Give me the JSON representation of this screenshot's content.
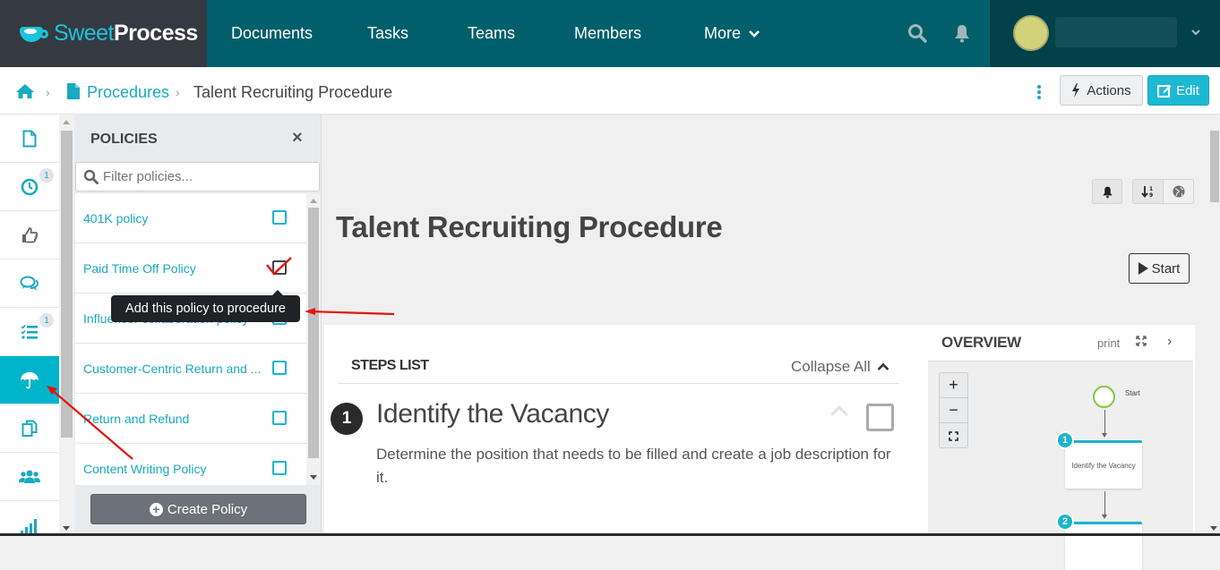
{
  "brand": {
    "name_part1": "Sweet",
    "name_part2": "Process"
  },
  "topnav": {
    "items": [
      "Documents",
      "Tasks",
      "Teams",
      "Members",
      "More"
    ],
    "search_icon": "search-icon",
    "bell_icon": "bell-icon",
    "user_caret": "⌄"
  },
  "breadcrumb": {
    "home_icon": "home-icon",
    "procedures": "Procedures",
    "current": "Talent Recruiting Procedure"
  },
  "header_actions": {
    "actions_label": "Actions",
    "edit_label": "Edit"
  },
  "sidebar": {
    "items": [
      {
        "icon": "document-icon",
        "badge": ""
      },
      {
        "icon": "clock-icon",
        "badge": "1"
      },
      {
        "icon": "thumbs-up-icon",
        "badge": ""
      },
      {
        "icon": "comments-icon",
        "badge": ""
      },
      {
        "icon": "checklist-icon",
        "badge": "1"
      },
      {
        "icon": "umbrella-icon",
        "badge": "",
        "active": true
      },
      {
        "icon": "copy-icon",
        "badge": ""
      },
      {
        "icon": "users-icon",
        "badge": ""
      },
      {
        "icon": "signal-icon",
        "badge": ""
      }
    ]
  },
  "policies_panel": {
    "title": "POLICIES",
    "close": "×",
    "filter_placeholder": "Filter policies...",
    "items": [
      {
        "name": "401K policy",
        "checked": false
      },
      {
        "name": "Paid Time Off Policy",
        "checked": true
      },
      {
        "name": "Influencer collaboration policy",
        "checked": false
      },
      {
        "name": "Customer-Centric Return and ...",
        "checked": false
      },
      {
        "name": "Return and Refund",
        "checked": false
      },
      {
        "name": "Content Writing Policy",
        "checked": false
      }
    ],
    "create_label": "Create Policy",
    "tooltip": "Add this policy to procedure"
  },
  "procedure": {
    "title": "Talent Recruiting Procedure",
    "start_label": "Start"
  },
  "steps": {
    "header": "STEPS LIST",
    "collapse_label": "Collapse All",
    "items": [
      {
        "number": "1",
        "title": "Identify the Vacancy",
        "description": "Determine the position that needs to be filled and create a job description for it."
      }
    ]
  },
  "overview": {
    "title": "OVERVIEW",
    "print_label": "print",
    "next": "›",
    "zoom_in": "+",
    "zoom_out": "−",
    "flow": {
      "start_label": "Start",
      "steps": [
        {
          "number": "1",
          "label": "Identify the Vacancy"
        },
        {
          "number": "2",
          "label": ""
        }
      ]
    }
  },
  "colors": {
    "accent": "#1ab4cf",
    "topbar": "#005f6b",
    "logo_bg": "#353a40",
    "annotation": "#e8120c"
  }
}
